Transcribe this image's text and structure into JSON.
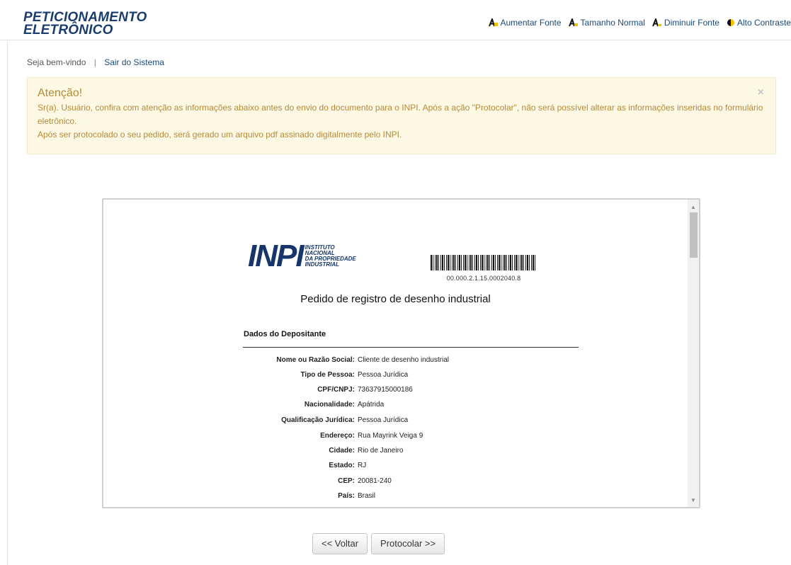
{
  "header": {
    "logo_line1": "PETICIONAMENTO",
    "logo_line2": "ELETRÔNICO",
    "accessibility": [
      {
        "label": "Aumentar Fonte",
        "icon": "font-increase-icon"
      },
      {
        "label": "Tamanho Normal",
        "icon": "font-normal-icon"
      },
      {
        "label": "Diminuir Fonte",
        "icon": "font-decrease-icon"
      },
      {
        "label": "Alto Contraste",
        "icon": "contrast-icon"
      }
    ]
  },
  "welcome": {
    "greeting": "Seja bem-vindo",
    "separator": "|",
    "logout": "Sair do Sistema"
  },
  "alert": {
    "title": "Atenção!",
    "line1": "Sr(a). Usuário, confira com atenção as informações abaixo antes do envio do documento para o INPI. Após a ação \"Protocolar\", não será possível alterar as informações inseridas no formulário eletrônico.",
    "line2": "Após ser protocolado o seu pedido, será gerado um arquivo pdf assinado digitalmente pelo INPI.",
    "close": "×"
  },
  "document": {
    "logo_letters": "INPI",
    "logo_text": [
      "INSTITUTO",
      "NACIONAL",
      "DA PROPRIEDADE",
      "INDUSTRIAL"
    ],
    "barcode_number": "00.000.2.1.15.0002040.8",
    "title": "Pedido de registro de desenho industrial",
    "section": "Dados do Depositante",
    "fields": [
      {
        "label": "Nome ou Razão Social:",
        "value": "Cliente de desenho industrial"
      },
      {
        "label": "Tipo de Pessoa:",
        "value": "Pessoa Jurídica"
      },
      {
        "label": "CPF/CNPJ:",
        "value": "73637915000186"
      },
      {
        "label": "Nacionalidade:",
        "value": "Apátrida"
      },
      {
        "label": "Qualificação Jurídica:",
        "value": "Pessoa Jurídica"
      },
      {
        "label": "Endereço:",
        "value": "Rua Mayrink Veiga 9"
      },
      {
        "label": "Cidade:",
        "value": "Rio de Janeiro"
      },
      {
        "label": "Estado:",
        "value": "RJ"
      },
      {
        "label": "CEP:",
        "value": "20081-240"
      },
      {
        "label": "País:",
        "value": "Brasil"
      }
    ]
  },
  "buttons": {
    "back": "<< Voltar",
    "submit": "Protocolar >>"
  },
  "colors": {
    "brand": "#1a3d6e",
    "alert_bg": "#fcf8e3",
    "alert_text": "#b7893a",
    "link": "#1a4a7a"
  }
}
